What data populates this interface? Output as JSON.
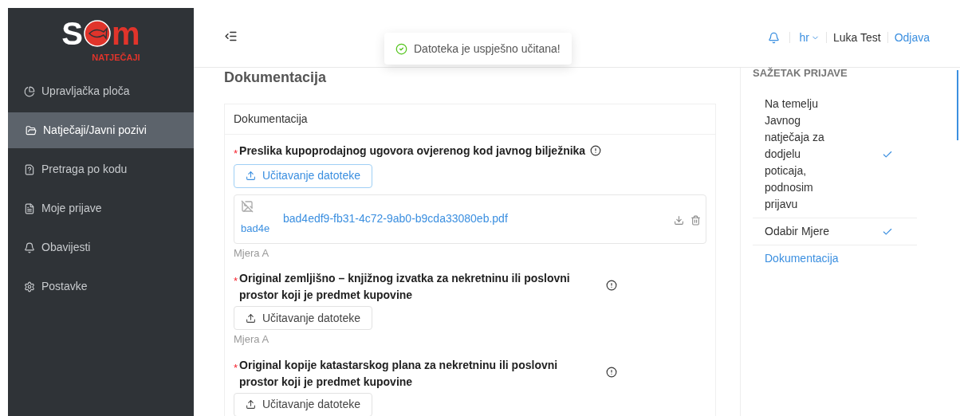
{
  "logo": {
    "left": "S",
    "right": "m",
    "sub": "NATJEČAJI"
  },
  "sidebar": {
    "items": [
      {
        "label": "Upravljačka ploča",
        "selected": false
      },
      {
        "label": "Natječaji/Javni pozivi",
        "selected": true
      },
      {
        "label": "Pretraga po kodu",
        "selected": false
      },
      {
        "label": "Moje prijave",
        "selected": false
      },
      {
        "label": "Obavijesti",
        "selected": false
      },
      {
        "label": "Postavke",
        "selected": false
      }
    ]
  },
  "header": {
    "language": "hr",
    "user": "Luka Test",
    "logout": "Odjava"
  },
  "toast": {
    "message": "Datoteka je uspješno učitana!"
  },
  "page_title": "Dokumentacija",
  "card": {
    "title": "Dokumentacija",
    "documents": [
      {
        "marker": "*",
        "label": "Preslika kupoprodajnog ugovora ovjerenog kod javnog bilježnika",
        "upload_button": "Učitavanje datoteke",
        "upload_active": true,
        "files": [
          {
            "alt": "bad4e",
            "name": "bad4edf9-fb31-4c72-9ab0-b9cda33080eb.pdf"
          }
        ],
        "measure": "Mjera A"
      },
      {
        "marker": "*",
        "label": "Original zemljišno – knjižnog izvatka za nekretninu ili poslovni prostor koji je predmet kupovine",
        "upload_button": "Učitavanje datoteke",
        "upload_active": false,
        "measure": "Mjera A"
      },
      {
        "marker": "*",
        "label": "Original kopije katastarskog plana za nekretninu ili poslovni prostor koji je predmet kupovine",
        "upload_button": "Učitavanje datoteke",
        "upload_active": false
      }
    ]
  },
  "summary": {
    "title": "SAŽETAK PRIJAVE",
    "steps": [
      {
        "label": "Na temelju Javnog natječaja za dodjelu poticaja, podnosim prijavu",
        "done": true,
        "selected": false
      },
      {
        "label": "Odabir Mjere",
        "done": true,
        "selected": false
      },
      {
        "label": "Dokumentacija",
        "done": false,
        "selected": true
      }
    ]
  }
}
